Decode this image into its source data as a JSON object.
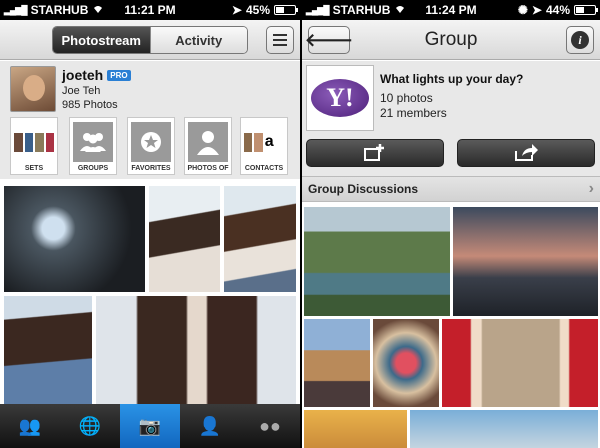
{
  "left": {
    "status": {
      "carrier": "STARHUB",
      "time": "11:21 PM",
      "battery": "45%",
      "battery_level": 0.45
    },
    "segments": [
      {
        "label": "Photostream",
        "active": true
      },
      {
        "label": "Activity",
        "active": false
      }
    ],
    "profile": {
      "username": "joeteh",
      "badge": "PRO",
      "real_name": "Joe Teh",
      "photo_count": "985 Photos"
    },
    "tiles": [
      {
        "label": "SETS"
      },
      {
        "label": "GROUPS"
      },
      {
        "label": "FAVORITES"
      },
      {
        "label": "PHOTOS OF"
      },
      {
        "label": "CONTACTS"
      }
    ],
    "tabbar": [
      {
        "icon": "people-icon",
        "glyph": "👥"
      },
      {
        "icon": "globe-icon",
        "glyph": "🌐"
      },
      {
        "icon": "camera-icon",
        "glyph": "📷"
      },
      {
        "icon": "person-icon",
        "glyph": "👤"
      },
      {
        "icon": "flickr-dots-icon",
        "glyph": "●●"
      }
    ],
    "colors": {
      "accent": "#1a7fd6",
      "pro_badge": "#2a7fd4"
    }
  },
  "right": {
    "status": {
      "carrier": "STARHUB",
      "time": "11:24 PM",
      "battery": "44%",
      "battery_level": 0.44
    },
    "title": "Group",
    "group": {
      "question": "What lights up your day?",
      "photos": "10 photos",
      "members": "21 members",
      "logo_text": "Y!"
    },
    "discussions_label": "Group Discussions"
  }
}
